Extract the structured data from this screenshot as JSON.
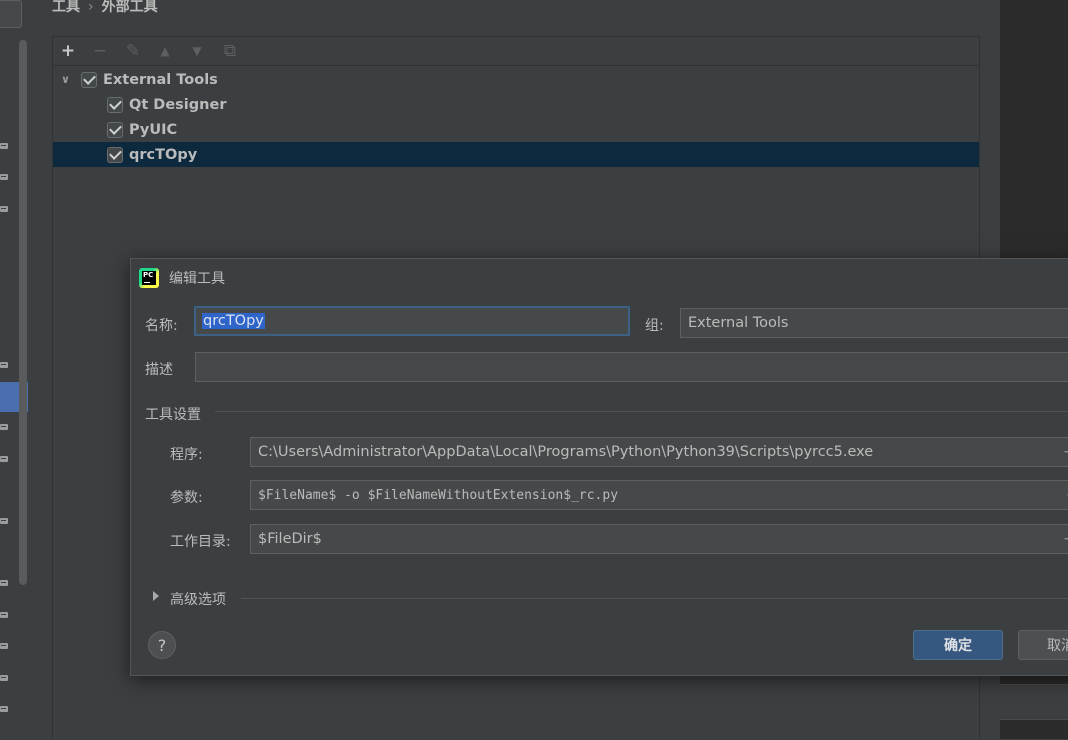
{
  "breadcrumb": {
    "parent": "工具",
    "separator": "›",
    "current": "外部工具"
  },
  "toolbar": {
    "add": "+",
    "remove": "−",
    "edit": "✎",
    "move_up": "▲",
    "move_down": "▼",
    "copy": "⧉",
    "icons": [
      "add-icon",
      "remove-icon",
      "edit-icon",
      "move-up-icon",
      "move-down-icon",
      "copy-icon"
    ]
  },
  "tree": {
    "group": {
      "label": "External Tools",
      "expanded": true,
      "checked": true
    },
    "items": [
      {
        "label": "Qt Designer",
        "checked": true,
        "selected": false
      },
      {
        "label": "PyUIC",
        "checked": true,
        "selected": false
      },
      {
        "label": "qrcTOpy",
        "checked": true,
        "selected": true
      }
    ]
  },
  "dialog": {
    "title": "编辑工具",
    "logo_text": "PC",
    "name_label": "名称:",
    "name_value": "qrcTOpy",
    "group_label": "组:",
    "group_value": "External Tools",
    "description_label": "描述",
    "description_value": "",
    "tool_settings_label": "工具设置",
    "program_label": "程序:",
    "program_value": "C:\\Users\\Administrator\\AppData\\Local\\Programs\\Python\\Python39\\Scripts\\pyrcc5.exe",
    "arguments_label": "参数:",
    "arguments_value": "$FileName$ -o $FileNameWithoutExtension$_rc.py",
    "working_dir_label": "工作目录:",
    "working_dir_value": "$FileDir$",
    "field_plus": "+",
    "advanced_label": "高级选项",
    "help": "?",
    "ok": "确定",
    "cancel": "取消"
  },
  "colors": {
    "background": "#3c3f41",
    "selection": "#0d293e",
    "accent_button": "#365880",
    "text_selection": "#2f65ca",
    "focus_border": "#3d6185"
  }
}
